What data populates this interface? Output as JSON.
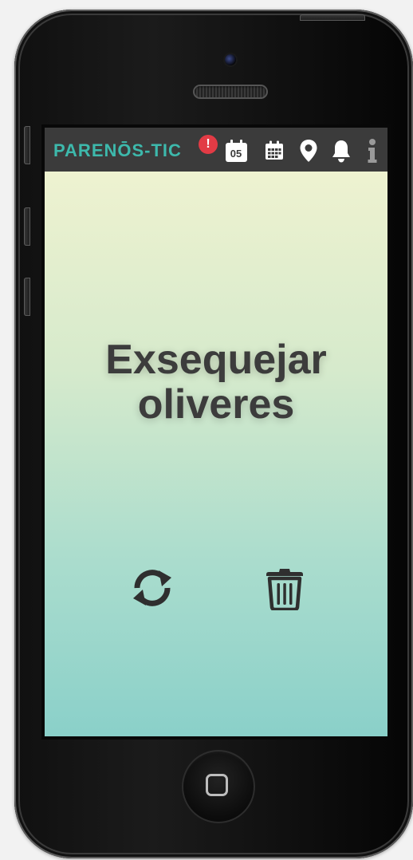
{
  "app": {
    "logo_text": "PARENŌS-TIC",
    "alert_badge": "!",
    "brand_color": "#3db9ac",
    "alert_color": "#e23b45"
  },
  "topbar": {
    "day_number": "05",
    "icons": [
      "calendar-day-icon",
      "calendar-month-icon",
      "location-pin-icon",
      "bell-icon",
      "info-icon"
    ]
  },
  "task": {
    "title": "Exsequejar oliveres"
  },
  "actions": {
    "icons": [
      "refresh-icon",
      "trash-icon"
    ]
  }
}
